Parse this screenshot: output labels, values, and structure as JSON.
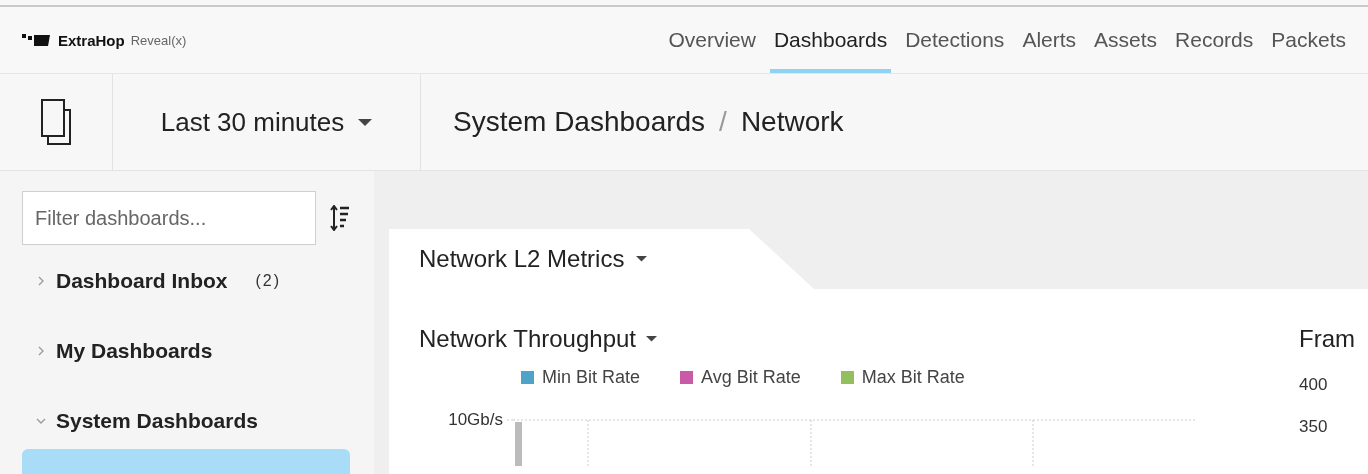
{
  "brand": {
    "name": "ExtraHop",
    "product": "Reveal(x)"
  },
  "nav": [
    {
      "label": "Overview",
      "selected": false
    },
    {
      "label": "Dashboards",
      "selected": true
    },
    {
      "label": "Detections",
      "selected": false
    },
    {
      "label": "Alerts",
      "selected": false
    },
    {
      "label": "Assets",
      "selected": false
    },
    {
      "label": "Records",
      "selected": false
    },
    {
      "label": "Packets",
      "selected": false
    }
  ],
  "toolbar": {
    "time_range": "Last 30 minutes",
    "breadcrumb": [
      "System Dashboards",
      "Network"
    ],
    "separator": "/"
  },
  "sidebar": {
    "filter": {
      "placeholder": "Filter dashboards..."
    },
    "items": [
      {
        "label": "Dashboard Inbox",
        "count": "(2)",
        "expanded": false
      },
      {
        "label": "My Dashboards",
        "expanded": false
      },
      {
        "label": "System Dashboards",
        "expanded": true
      }
    ]
  },
  "dashboard": {
    "tab": "Network L2 Metrics",
    "widgets": [
      {
        "kind": "throughput",
        "title": "Network Throughput",
        "legend": [
          {
            "label": "Min Bit Rate",
            "color": "#4fa3c9"
          },
          {
            "label": "Avg Bit Rate",
            "color": "#c95aa6"
          },
          {
            "label": "Max Bit Rate",
            "color": "#94bf5e"
          }
        ],
        "y_ticks": [
          "10Gb/s"
        ]
      },
      {
        "kind": "frames",
        "title": "Fram",
        "y_ticks": [
          "400",
          "350"
        ]
      }
    ]
  }
}
